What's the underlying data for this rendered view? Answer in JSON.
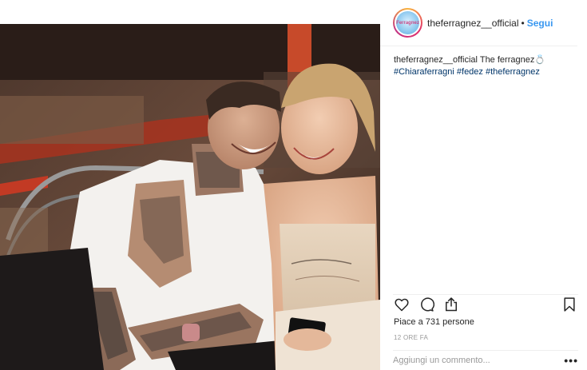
{
  "post": {
    "username": "theferragnez__official",
    "separator": "•",
    "follow_label": "Segui",
    "avatar_text": "Ferragnez",
    "caption": {
      "user": "theferragnez__official",
      "text": "The ferragnez",
      "emoji": "💍",
      "hashtags": [
        "#Chiaraferragni",
        "#fedez",
        "#theferragnez"
      ]
    },
    "likes_text": "Piace a 731 persone",
    "time_text": "12 ORE FA",
    "comment_placeholder": "Aggiungi un commento...",
    "more_label": "•••"
  },
  "icons": {
    "like": "heart-icon",
    "comment": "comment-icon",
    "share": "share-icon",
    "save": "bookmark-icon",
    "more": "more-options-icon"
  },
  "colors": {
    "link_blue": "#3897f0",
    "hashtag": "#003569",
    "muted": "#999999",
    "text": "#262626"
  }
}
